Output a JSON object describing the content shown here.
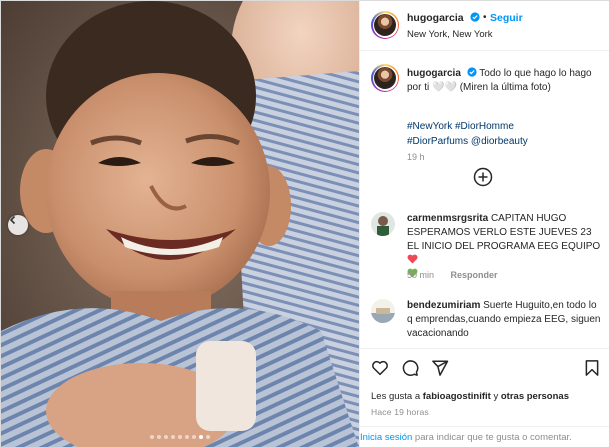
{
  "post": {
    "username": "hugogarcia",
    "separator": "•",
    "follow_label": "Seguir",
    "location": "New York, New York"
  },
  "caption": {
    "username": "hugogarcia",
    "text": "Todo lo que hago lo hago por ti 🤍🤍 (Miren la última foto)",
    "hashtags": [
      "#NewYork",
      "#DiorHomme",
      "#DiorParfums",
      "@diorbeauty"
    ],
    "time": "19 h"
  },
  "comments": [
    {
      "username": "carmenmsrgsrita",
      "text": "CAPITAN HUGO ESPERAMOS VERLO ESTE JUEVES 23 EL INICIO DEL PROGRAMA EEG EQUIPO",
      "time": "50 min",
      "reply_label": "Responder"
    },
    {
      "username": "bendezumiriam",
      "text": "Suerte Huguito,en todo lo q emprendas,cuando empieza EEG, siguen vacacionando"
    }
  ],
  "likes": {
    "prefix": "Les gusta a",
    "user": "fabioagostinifit",
    "suffix": "y",
    "others": "otras personas"
  },
  "date_label": "Hace 19 horas",
  "login": {
    "link": "Inicia sesión",
    "rest": "para indicar que te gusta o comentar."
  },
  "media": {
    "current_slide": 8,
    "total_slides": 9
  },
  "colors": {
    "link_blue": "#0095f6",
    "hashtag_blue": "#00376b",
    "heart_red": "#ed4956",
    "heart_green": "#78b159"
  },
  "icons": [
    "verified-icon",
    "more-icon",
    "heart-icon",
    "comment-icon",
    "share-icon",
    "bookmark-icon",
    "chevron-left-icon"
  ]
}
